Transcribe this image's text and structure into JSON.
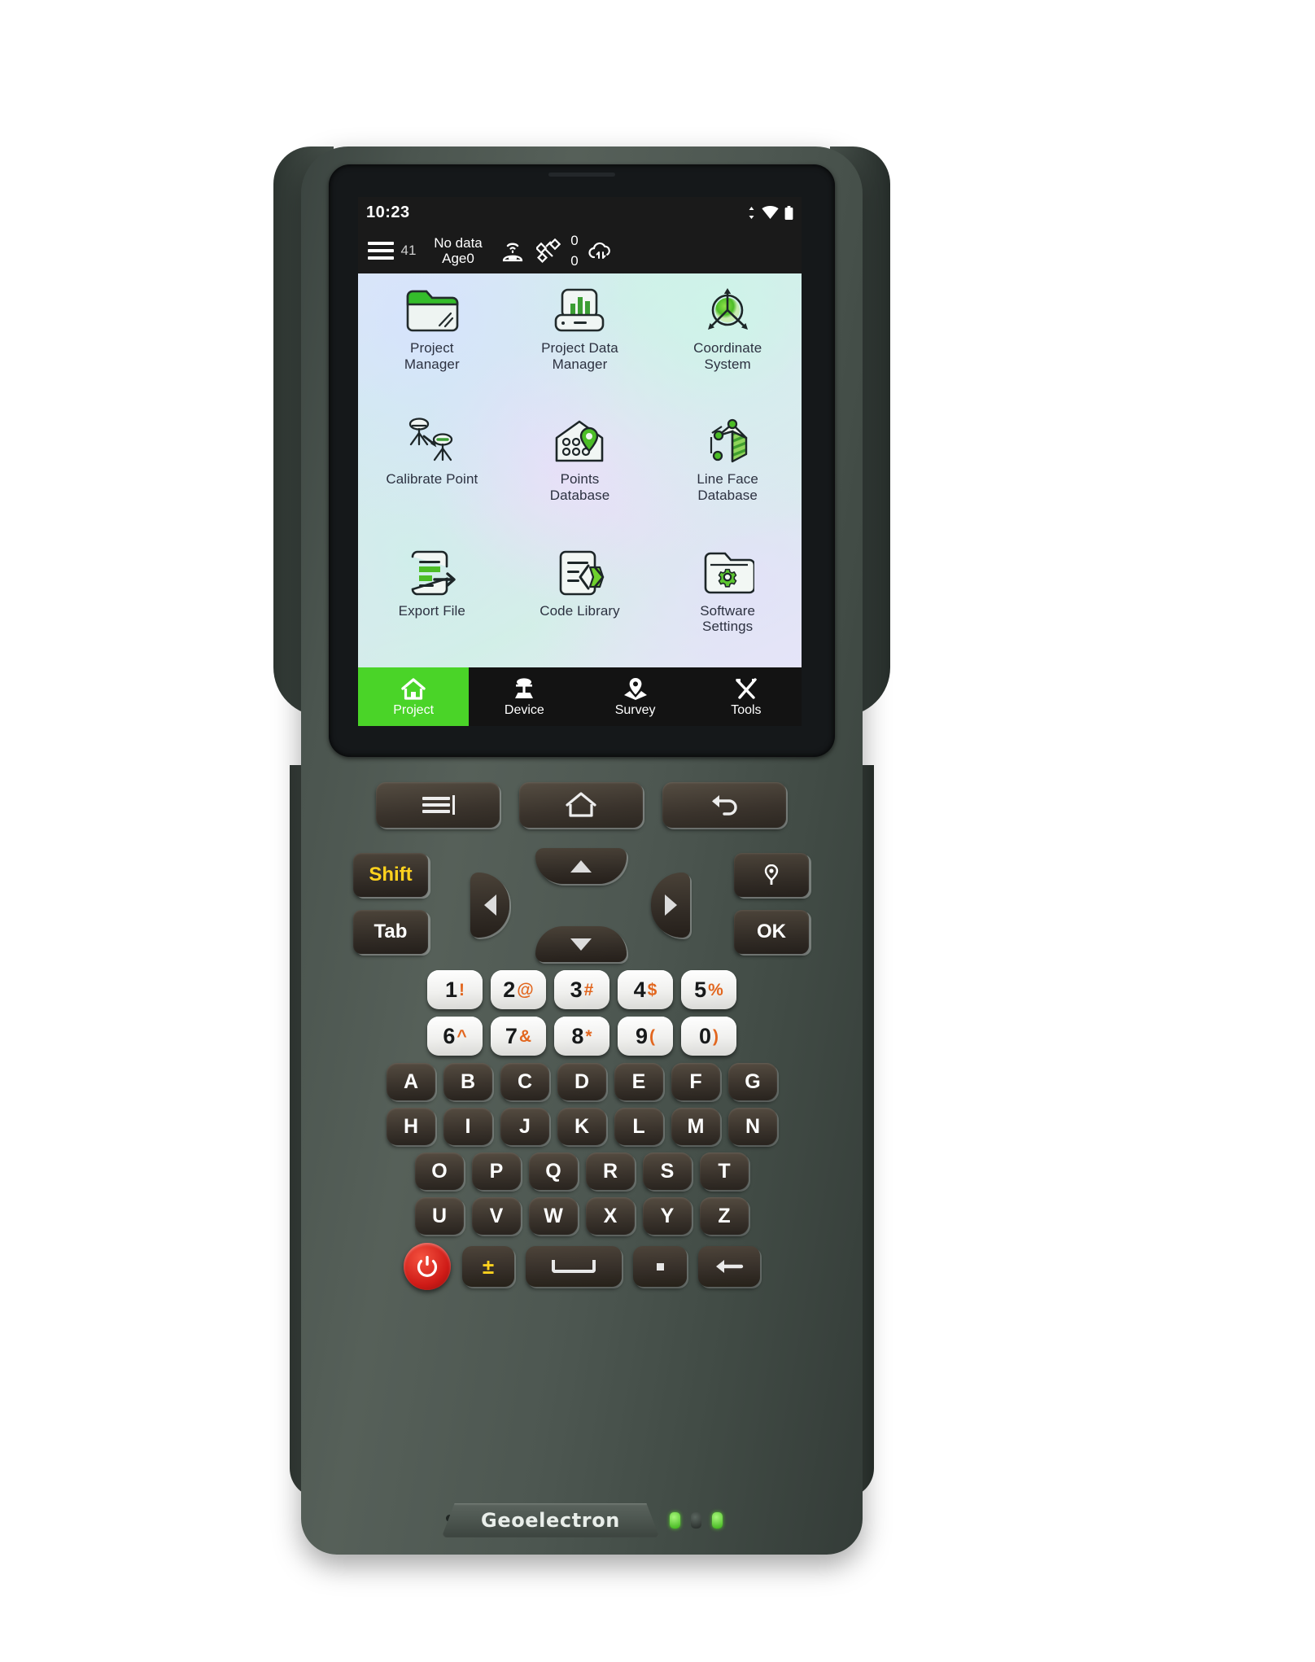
{
  "device": {
    "brand": "Geoelectron",
    "form_factor": "rugged-handheld-gnss-controller"
  },
  "screen": {
    "status_bar": {
      "clock": "10:23",
      "icons": [
        "data-transfer-icon",
        "wifi-icon",
        "battery-icon"
      ]
    },
    "app_toolbar": {
      "menu_icon": "hamburger-menu-icon",
      "satellite_count": "41",
      "solution_status": "No data",
      "age_status": "Age0",
      "base_icon": "base-station-icon",
      "satellite_icon": "satellite-icon",
      "counter_top": "0",
      "counter_bottom": "0",
      "cloud_icon": "cloud-transfer-icon"
    },
    "apps": [
      {
        "id": "project-manager",
        "label": "Project\nManager",
        "icon": "folder-icon"
      },
      {
        "id": "project-data-manager",
        "label": "Project Data\nManager",
        "icon": "data-chart-box-icon"
      },
      {
        "id": "coordinate-system",
        "label": "Coordinate\nSystem",
        "icon": "axes-globe-icon"
      },
      {
        "id": "calibrate-point",
        "label": "Calibrate Point",
        "icon": "two-tripods-icon"
      },
      {
        "id": "points-database",
        "label": "Points\nDatabase",
        "icon": "house-pin-icon"
      },
      {
        "id": "line-face-database",
        "label": "Line Face\nDatabase",
        "icon": "polygon-face-icon"
      },
      {
        "id": "export-file",
        "label": "Export File",
        "icon": "document-export-icon"
      },
      {
        "id": "code-library",
        "label": "Code Library",
        "icon": "document-code-icon"
      },
      {
        "id": "software-settings",
        "label": "Software\nSettings",
        "icon": "folder-gear-icon"
      }
    ],
    "tabs": [
      {
        "id": "project",
        "label": "Project",
        "icon": "home-icon",
        "active": true
      },
      {
        "id": "device",
        "label": "Device",
        "icon": "receiver-icon",
        "active": false
      },
      {
        "id": "survey",
        "label": "Survey",
        "icon": "map-pin-icon",
        "active": false
      },
      {
        "id": "tools",
        "label": "Tools",
        "icon": "tools-icon",
        "active": false
      }
    ],
    "accent_color": "#4ad428",
    "tabbar_color": "#131313"
  },
  "hardware": {
    "nav_buttons": [
      {
        "id": "menu",
        "icon": "menu-bars-icon"
      },
      {
        "id": "home",
        "icon": "home-outline-icon"
      },
      {
        "id": "back",
        "icon": "back-arrow-icon"
      }
    ],
    "control_keys": {
      "shift": "Shift",
      "tab": "Tab",
      "pin": "map-pin-icon",
      "ok": "OK"
    },
    "dpad": [
      "up",
      "down",
      "left",
      "right"
    ],
    "number_rows": [
      [
        {
          "digit": "1",
          "symbol": "!"
        },
        {
          "digit": "2",
          "symbol": "@"
        },
        {
          "digit": "3",
          "symbol": "#"
        },
        {
          "digit": "4",
          "symbol": "$"
        },
        {
          "digit": "5",
          "symbol": "%"
        }
      ],
      [
        {
          "digit": "6",
          "symbol": "^"
        },
        {
          "digit": "7",
          "symbol": "&"
        },
        {
          "digit": "8",
          "symbol": "*"
        },
        {
          "digit": "9",
          "symbol": "("
        },
        {
          "digit": "0",
          "symbol": ")"
        }
      ]
    ],
    "alpha_rows": [
      [
        "A",
        "B",
        "C",
        "D",
        "E",
        "F",
        "G"
      ],
      [
        "H",
        "I",
        "J",
        "K",
        "L",
        "M",
        "N"
      ],
      [
        "O",
        "P",
        "Q",
        "R",
        "S",
        "T"
      ],
      [
        "U",
        "V",
        "W",
        "X",
        "Y",
        "Z"
      ]
    ],
    "function_keys": [
      {
        "id": "power",
        "icon": "power-icon",
        "color": "#cf1b17"
      },
      {
        "id": "plusminus",
        "glyph": "±",
        "color": "#ffd21e"
      },
      {
        "id": "space",
        "icon": "space-bar-icon"
      },
      {
        "id": "period",
        "icon": "dot-icon"
      },
      {
        "id": "backspace",
        "icon": "backspace-arrow-icon"
      }
    ],
    "leds": [
      "green",
      "dark",
      "green"
    ]
  }
}
